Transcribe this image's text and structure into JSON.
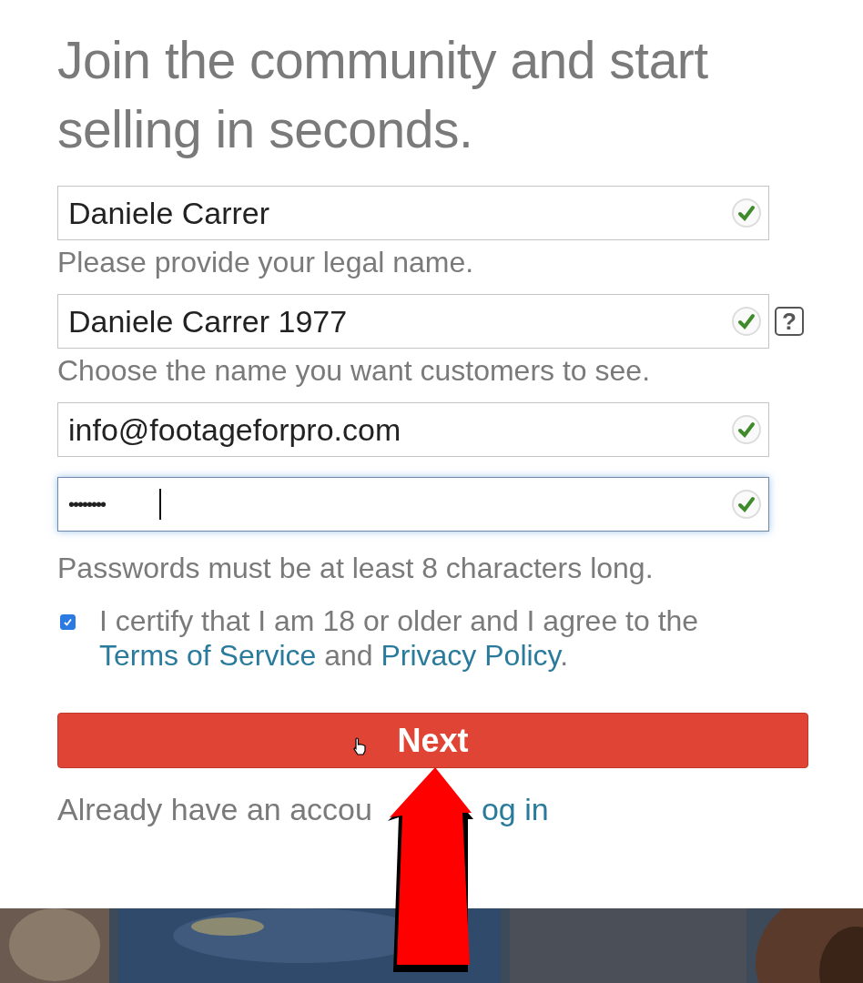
{
  "heading": "Join the community and start selling in seconds.",
  "fields": [
    {
      "kind": "text",
      "value": "Daniele Carrer",
      "valid": true,
      "focused": false,
      "hint": "Please provide your legal name."
    },
    {
      "kind": "text",
      "value": "Daniele Carrer 1977",
      "valid": true,
      "focused": false,
      "hint": "Choose the name you want customers to see.",
      "help": "?"
    },
    {
      "kind": "text",
      "value": "info@footageforpro.com",
      "valid": true,
      "focused": false
    },
    {
      "kind": "password",
      "value": "••••••••",
      "valid": true,
      "focused": true
    }
  ],
  "password_rule": "Passwords must be at least 8 characters long.",
  "agreement": {
    "checked": true,
    "text": "I certify that I am 18 or older and I agree to the",
    "terms_link": "Terms of Service",
    "joiner": "and",
    "privacy_link": "Privacy Policy",
    "end": "."
  },
  "next_button": "Next",
  "login_prompt": "Already have an accou",
  "login_link": "og in"
}
